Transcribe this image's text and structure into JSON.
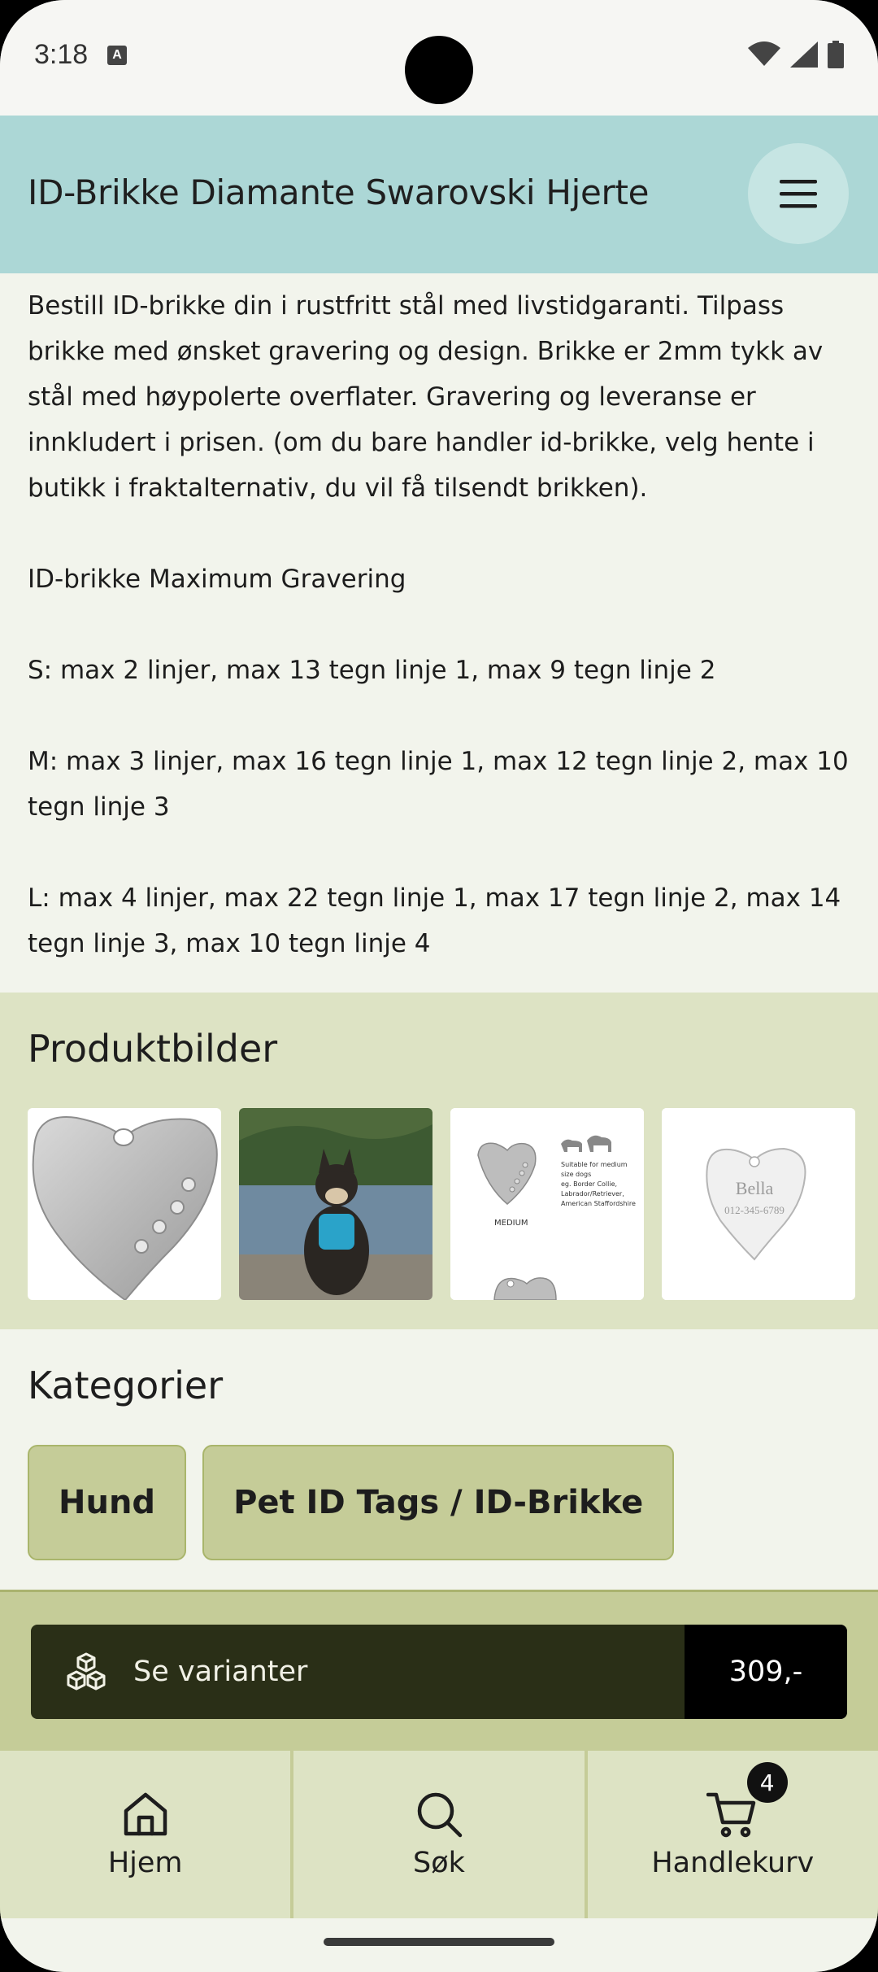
{
  "status_bar": {
    "time": "3:18",
    "notification_icon_letter": "A"
  },
  "header": {
    "title": "ID-Brikke Diamante Swarovski Hjerte",
    "menu_icon": "hamburger-menu-icon"
  },
  "description": {
    "paragraphs": [
      "Bestill ID-brikke din i rustfritt stål med livstidgaranti. Tilpass brikke med ønsket gravering og design. Brikke er 2mm tykk av stål med høypolerte overflater. Gravering og leveranse er innkludert i prisen. (om du bare handler id-brikke, velg hente i butikk i fraktalternativ, du vil få tilsendt brikken).",
      "ID-brikke Maximum Gravering",
      "S: max 2 linjer, max 13 tegn linje 1, max 9 tegn linje 2",
      "M: max 3 linjer, max 16 tegn linje 1, max 12 tegn linje 2, max 10 tegn linje 3",
      "L: max 4 linjer, max 22 tegn linje 1, max 17 tegn linje 2, max 14 tegn linje 3, max 10 tegn linje 4"
    ]
  },
  "product_images": {
    "title": "Produktbilder",
    "size_chart": {
      "size_label": "MEDIUM",
      "suitability_text": [
        "Suitable for medium",
        "size dogs",
        "eg. Border Collie,",
        "Labrador/Retriever,",
        "American Staffordshire"
      ]
    },
    "engraved_tag": {
      "name": "Bella",
      "phone": "012-345-6789"
    }
  },
  "categories": {
    "title": "Kategorier",
    "items": [
      "Hund",
      "Pet ID Tags / ID-Brikke"
    ]
  },
  "variant_bar": {
    "label": "Se varianter",
    "price": "309,-"
  },
  "bottom_nav": {
    "items": [
      {
        "label": "Hjem",
        "icon": "home-icon"
      },
      {
        "label": "Søk",
        "icon": "search-icon"
      },
      {
        "label": "Handlekurv",
        "icon": "cart-icon",
        "badge": "4"
      }
    ]
  },
  "colors": {
    "header_bg": "#acd7d6",
    "accent_olive": "#c5cc98",
    "section_bg": "#dde3c4",
    "variant_bar_bg": "#2a2f17"
  }
}
